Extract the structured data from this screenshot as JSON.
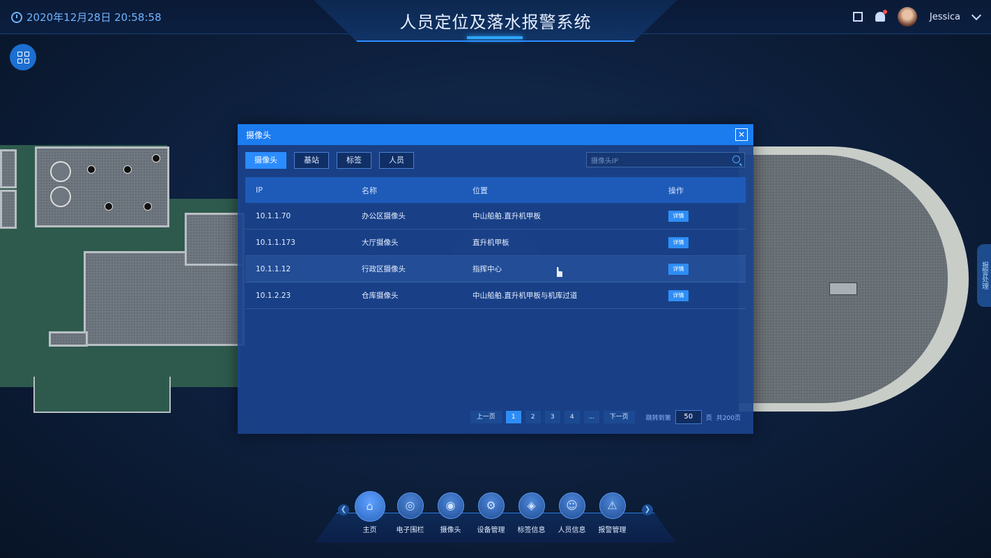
{
  "header": {
    "datetime": "2020年12月28日  20:58:58",
    "title": "人员定位及落水报警系统",
    "username": "Jessica"
  },
  "side_tab": "报警处理",
  "modal": {
    "title": "摄像头",
    "tabs": [
      "摄像头",
      "基站",
      "标签",
      "人员"
    ],
    "active_tab": "摄像头",
    "search_placeholder": "摄像头IP",
    "columns": [
      "IP",
      "名称",
      "位置",
      "操作"
    ],
    "rows": [
      {
        "ip": "10.1.1.70",
        "name": "办公区摄像头",
        "location": "中山船舶.直升机甲板",
        "action": "详情"
      },
      {
        "ip": "10.1.1.173",
        "name": "大厅摄像头",
        "location": "直升机甲板",
        "action": "详情"
      },
      {
        "ip": "10.1.1.12",
        "name": "行政区摄像头",
        "location": "指挥中心",
        "action": "详情"
      },
      {
        "ip": "10.1.2.23",
        "name": "仓库摄像头",
        "location": "中山船舶.直升机甲板与机库过道",
        "action": "详情"
      }
    ],
    "pagination": {
      "prev": "上一页",
      "pages": [
        "1",
        "2",
        "3",
        "4",
        "..."
      ],
      "current": "1",
      "next": "下一页",
      "jump_label": "跳转到第",
      "jump_value": "50",
      "page_unit": "页",
      "total": "共200页"
    }
  },
  "bottom_nav": [
    {
      "label": "主页",
      "icon": "home-icon"
    },
    {
      "label": "电子围栏",
      "icon": "fence-icon"
    },
    {
      "label": "摄像头",
      "icon": "camera-icon"
    },
    {
      "label": "设备管理",
      "icon": "gear-icon"
    },
    {
      "label": "标签信息",
      "icon": "tag-icon"
    },
    {
      "label": "人员信息",
      "icon": "people-icon"
    },
    {
      "label": "报警管理",
      "icon": "alarm-icon"
    }
  ],
  "colors": {
    "accent": "#2b8cff",
    "header_bg": "#0b1a33",
    "modal_head": "#1b7cf0"
  }
}
